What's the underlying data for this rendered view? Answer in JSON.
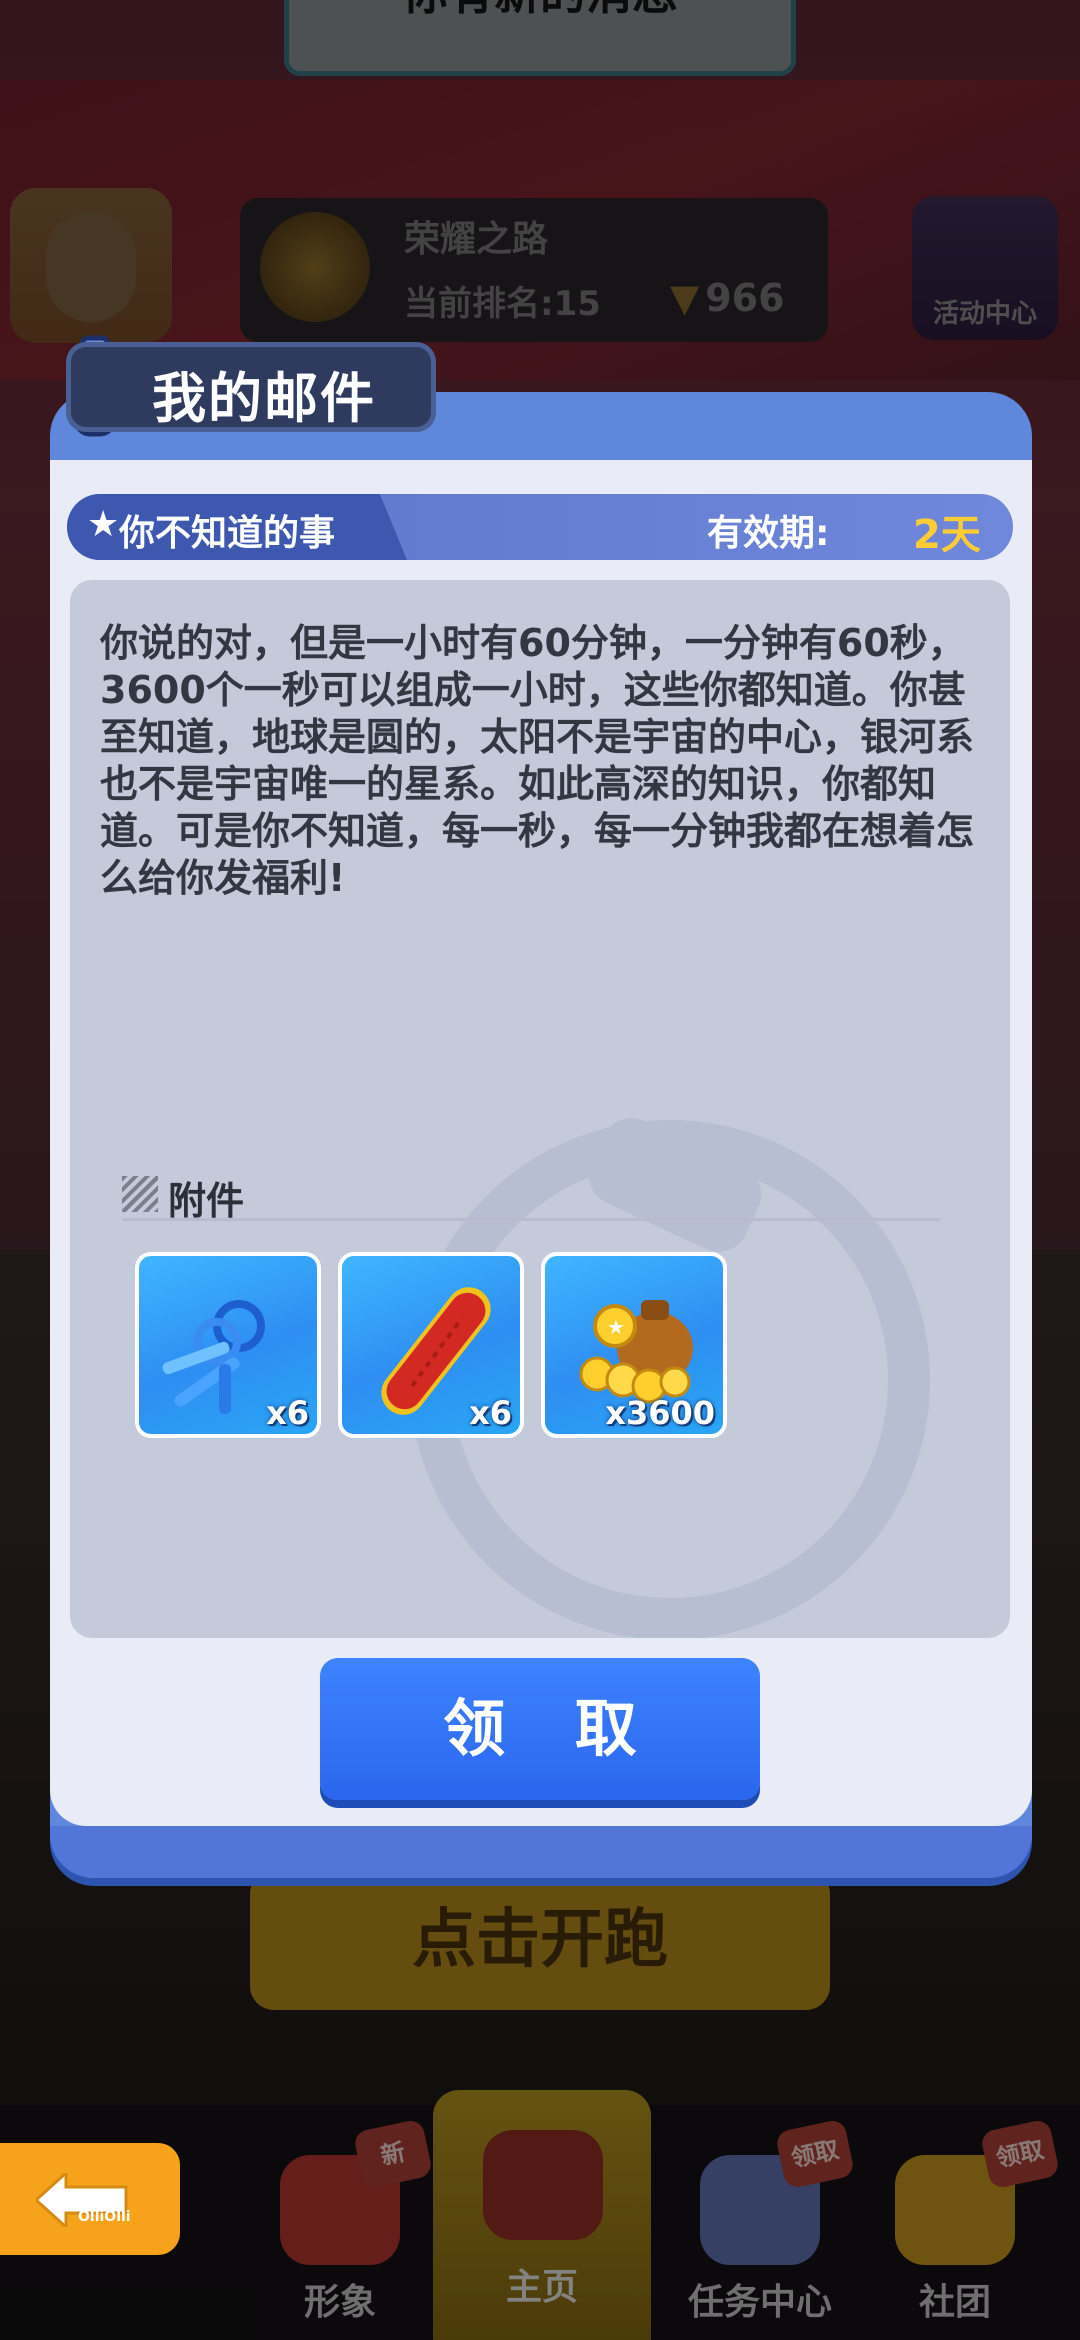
{
  "top_banner": {
    "text": "你有新的消息"
  },
  "profile": {
    "rank_title": "荣耀之路",
    "rank_text": "当前排名:15",
    "trophy_count": "966"
  },
  "activity": {
    "label": "活动中心"
  },
  "start": {
    "label": "点击开跑"
  },
  "mail": {
    "title": "我的邮件",
    "subject": "你不知道的事",
    "validity_label": "有效期:",
    "validity_value": "2天",
    "body": "你说的对，但是一小时有60分钟，一分钟有60秒，3600个一秒可以组成一小时，这些你都知道。你甚至知道，地球是圆的，太阳不是宇宙的中心，银河系也不是宇宙唯一的星系。如此高深的知识，你都知道。可是你不知道，每一秒，每一分钟我都在想着怎么给你发福利!",
    "attachments_label": "附件",
    "attachments": [
      {
        "icon": "keys-icon",
        "count": "x6"
      },
      {
        "icon": "hoverboard-icon",
        "count": "x6"
      },
      {
        "icon": "coins-bag-icon",
        "count": "x3600"
      }
    ],
    "claim_label": "领 取"
  },
  "nav": {
    "items": [
      {
        "label": "形象",
        "badge": "新"
      },
      {
        "label": "主页",
        "badge": ""
      },
      {
        "label": "任务中心",
        "badge": "领取"
      },
      {
        "label": "社团",
        "badge": "领取"
      }
    ]
  },
  "back": {
    "brand": "OlliOlli"
  },
  "colors": {
    "accent": "#2a66ee",
    "dialog": "#5f88dc",
    "validity": "#ffcc33",
    "back": "#f6a31b"
  }
}
